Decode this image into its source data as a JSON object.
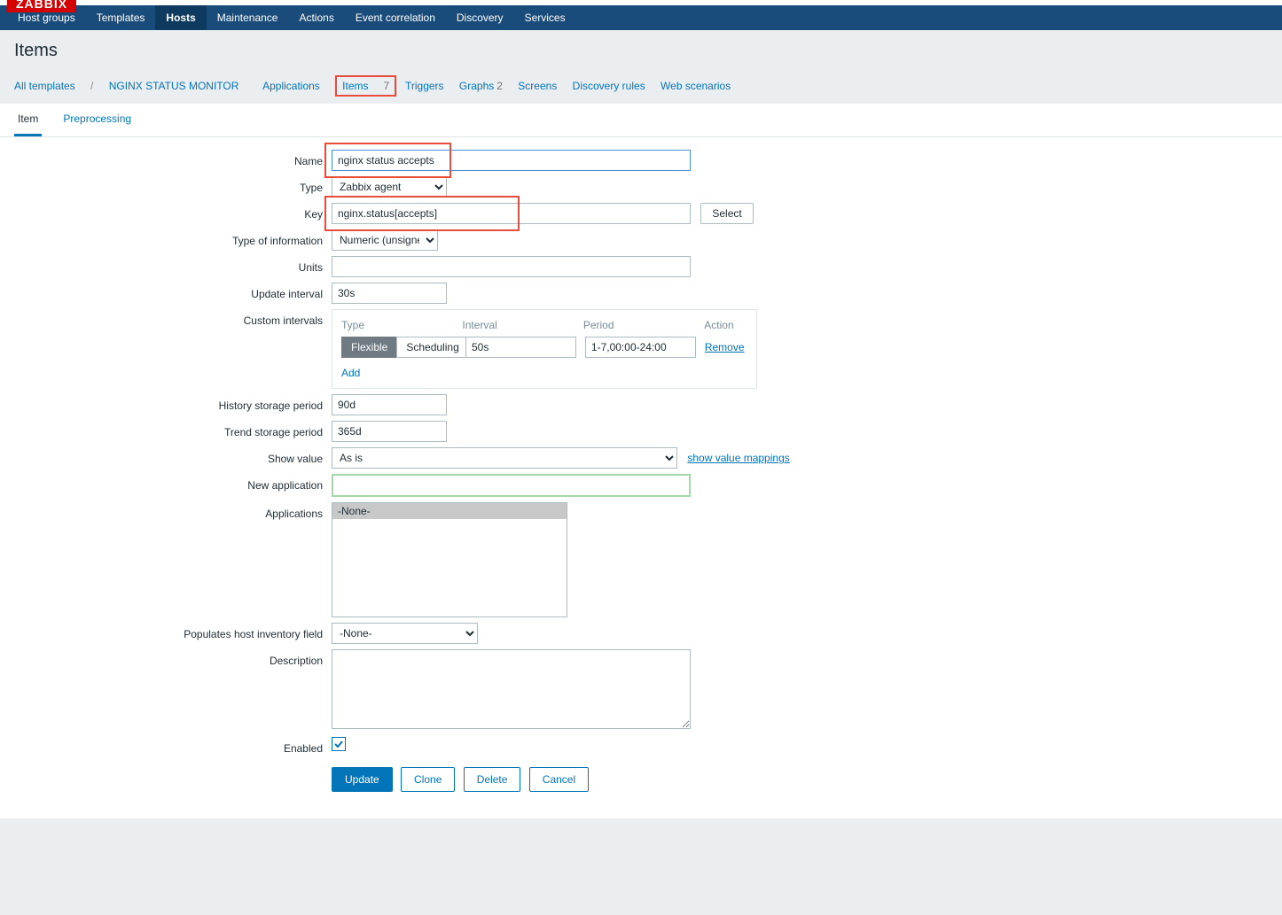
{
  "logo": "ZABBIX",
  "nav": [
    "Host groups",
    "Templates",
    "Hosts",
    "Maintenance",
    "Actions",
    "Event correlation",
    "Discovery",
    "Services"
  ],
  "nav_active_index": 2,
  "page_title": "Items",
  "breadcrumb": {
    "all_templates": "All templates",
    "template_name": "NGINX STATUS MONITOR",
    "links": [
      {
        "label": "Applications",
        "count": ""
      },
      {
        "label": "Items",
        "count": "7",
        "boxed": true
      },
      {
        "label": "Triggers",
        "count": ""
      },
      {
        "label": "Graphs",
        "count": "2"
      },
      {
        "label": "Screens",
        "count": ""
      },
      {
        "label": "Discovery rules",
        "count": ""
      },
      {
        "label": "Web scenarios",
        "count": ""
      }
    ]
  },
  "tabs": [
    "Item",
    "Preprocessing"
  ],
  "tabs_active_index": 0,
  "form": {
    "name_label": "Name",
    "name_value": "nginx status accepts",
    "type_label": "Type",
    "type_value": "Zabbix agent",
    "key_label": "Key",
    "key_value": "nginx.status[accepts]",
    "select_btn": "Select",
    "type_info_label": "Type of information",
    "type_info_value": "Numeric (unsigned)",
    "units_label": "Units",
    "units_value": "",
    "update_interval_label": "Update interval",
    "update_interval_value": "30s",
    "custom_intervals_label": "Custom intervals",
    "ci_headers": {
      "type": "Type",
      "interval": "Interval",
      "period": "Period",
      "action": "Action"
    },
    "ci_flexible": "Flexible",
    "ci_scheduling": "Scheduling",
    "ci_interval_value": "50s",
    "ci_period_value": "1-7,00:00-24:00",
    "ci_remove": "Remove",
    "ci_add": "Add",
    "history_label": "History storage period",
    "history_value": "90d",
    "trend_label": "Trend storage period",
    "trend_value": "365d",
    "show_value_label": "Show value",
    "show_value_value": "As is",
    "show_value_link": "show value mappings",
    "new_app_label": "New application",
    "new_app_value": "",
    "apps_label": "Applications",
    "apps_none": "-None-",
    "pop_label": "Populates host inventory field",
    "pop_value": "-None-",
    "desc_label": "Description",
    "desc_value": "",
    "enabled_label": "Enabled",
    "enabled_checked": true
  },
  "buttons": {
    "update": "Update",
    "clone": "Clone",
    "delete": "Delete",
    "cancel": "Cancel"
  }
}
